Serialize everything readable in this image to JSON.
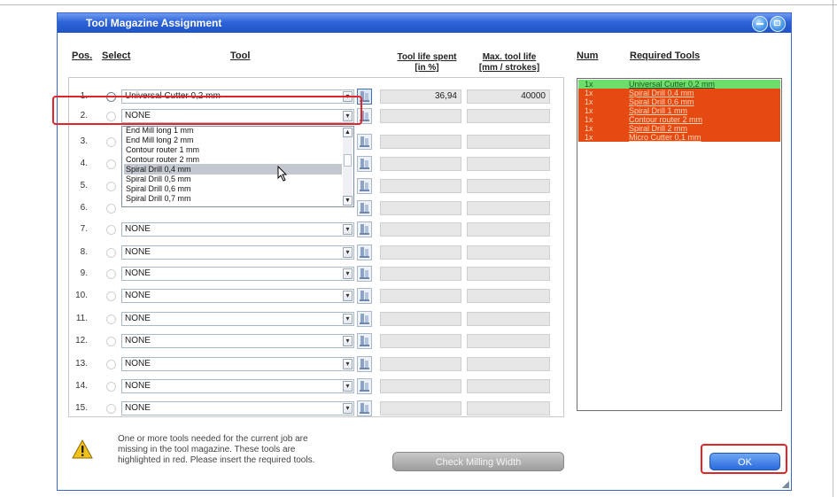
{
  "window": {
    "title": "Tool Magazine Assignment"
  },
  "headers": {
    "pos": "Pos.",
    "select": "Select",
    "tool": "Tool",
    "life_spent_1": "Tool life spent",
    "life_spent_2": "[in %]",
    "max_life_1": "Max. tool life",
    "max_life_2": "[mm / strokes]",
    "num": "Num",
    "required": "Required Tools"
  },
  "rows": [
    {
      "pos": "1.",
      "tool": "Universal Cutter 0,2 mm",
      "life_spent": "36,94",
      "max_life": "40000",
      "selected": true
    },
    {
      "pos": "2.",
      "tool": "NONE",
      "life_spent": "",
      "max_life": ""
    },
    {
      "pos": "3.",
      "tool": "",
      "life_spent": "",
      "max_life": ""
    },
    {
      "pos": "4.",
      "tool": "",
      "life_spent": "",
      "max_life": ""
    },
    {
      "pos": "5.",
      "tool": "",
      "life_spent": "",
      "max_life": ""
    },
    {
      "pos": "6.",
      "tool": "",
      "life_spent": "",
      "max_life": ""
    },
    {
      "pos": "7.",
      "tool": "NONE",
      "life_spent": "",
      "max_life": ""
    },
    {
      "pos": "8.",
      "tool": "NONE",
      "life_spent": "",
      "max_life": ""
    },
    {
      "pos": "9.",
      "tool": "NONE",
      "life_spent": "",
      "max_life": ""
    },
    {
      "pos": "10.",
      "tool": "NONE",
      "life_spent": "",
      "max_life": ""
    },
    {
      "pos": "11.",
      "tool": "NONE",
      "life_spent": "",
      "max_life": ""
    },
    {
      "pos": "12.",
      "tool": "NONE",
      "life_spent": "",
      "max_life": ""
    },
    {
      "pos": "13.",
      "tool": "NONE",
      "life_spent": "",
      "max_life": ""
    },
    {
      "pos": "14.",
      "tool": "NONE",
      "life_spent": "",
      "max_life": ""
    },
    {
      "pos": "15.",
      "tool": "NONE",
      "life_spent": "",
      "max_life": ""
    }
  ],
  "dropdown": {
    "items": [
      "End Mill long 1 mm",
      "End Mill long 2 mm",
      "Contour router 1 mm",
      "Contour router 2 mm",
      "Spiral Drill 0,4 mm",
      "Spiral Drill 0,5 mm",
      "Spiral Drill 0,6 mm",
      "Spiral Drill 0,7 mm"
    ],
    "highlighted": "Spiral Drill 0,4 mm"
  },
  "required_tools": [
    {
      "num": "1x",
      "name": "Universal Cutter 0,2 mm",
      "status": "ok"
    },
    {
      "num": "1x",
      "name": "Spiral Drill 0,4 mm",
      "status": "missing"
    },
    {
      "num": "1x",
      "name": "Spiral Drill 0,6 mm",
      "status": "missing"
    },
    {
      "num": "1x",
      "name": "Spiral Drill 1 mm",
      "status": "missing"
    },
    {
      "num": "1x",
      "name": "Contour router 2 mm",
      "status": "missing"
    },
    {
      "num": "1x",
      "name": "Spiral Drill 2 mm",
      "status": "missing"
    },
    {
      "num": "1x",
      "name": "Micro Cutter 0,1 mm",
      "status": "missing"
    }
  ],
  "message": {
    "line1": "One or more tools needed for the current job are",
    "line2": "missing in the tool magazine. These tools are",
    "line3": "highlighted in red. Please insert the required tools."
  },
  "buttons": {
    "check_milling_width": "Check Milling Width",
    "ok": "OK"
  },
  "colors": {
    "ok": "#6dde6a",
    "missing": "#e64a13",
    "highlight": "#e0262a",
    "title_bar": "#2e64d8"
  }
}
